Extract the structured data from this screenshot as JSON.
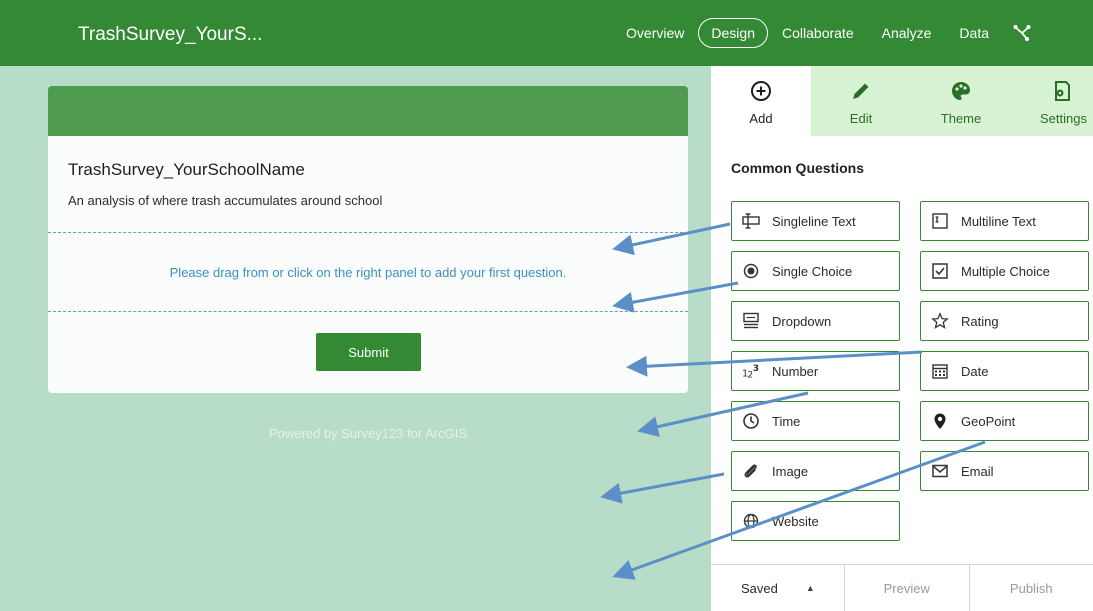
{
  "header": {
    "app_title": "TrashSurvey_YourS...",
    "nav": [
      {
        "label": "Overview",
        "active": false
      },
      {
        "label": "Design",
        "active": true
      },
      {
        "label": "Collaborate",
        "active": false
      },
      {
        "label": "Analyze",
        "active": false
      },
      {
        "label": "Data",
        "active": false
      }
    ],
    "share_icon": "share-icon"
  },
  "survey": {
    "title": "TrashSurvey_YourSchoolName",
    "description": "An analysis of where trash accumulates around school",
    "dropzone_text": "Please drag from or click on the right panel to add your first question.",
    "submit_label": "Submit",
    "powered_by": "Powered by Survey123 for ArcGIS"
  },
  "panel": {
    "tabs": [
      {
        "label": "Add",
        "icon": "plus-circle-icon",
        "active": true
      },
      {
        "label": "Edit",
        "icon": "pencil-icon",
        "active": false
      },
      {
        "label": "Theme",
        "icon": "palette-icon",
        "active": false
      },
      {
        "label": "Settings",
        "icon": "settings-doc-icon",
        "active": false
      }
    ],
    "section_title": "Common Questions",
    "questions": [
      {
        "label": "Singleline Text",
        "icon": "singleline-text-icon"
      },
      {
        "label": "Multiline Text",
        "icon": "multiline-text-icon"
      },
      {
        "label": "Single Choice",
        "icon": "radio-icon"
      },
      {
        "label": "Multiple Choice",
        "icon": "checkbox-icon"
      },
      {
        "label": "Dropdown",
        "icon": "dropdown-icon"
      },
      {
        "label": "Rating",
        "icon": "star-icon"
      },
      {
        "label": "Number",
        "icon": "number-icon"
      },
      {
        "label": "Date",
        "icon": "calendar-icon"
      },
      {
        "label": "Time",
        "icon": "clock-icon"
      },
      {
        "label": "GeoPoint",
        "icon": "map-pin-icon"
      },
      {
        "label": "Image",
        "icon": "paperclip-icon"
      },
      {
        "label": "Email",
        "icon": "envelope-icon"
      },
      {
        "label": "Website",
        "icon": "globe-icon"
      }
    ],
    "bottom": {
      "saved_label": "Saved",
      "preview_label": "Preview",
      "publish_label": "Publish"
    }
  },
  "colors": {
    "brand_green": "#348a34",
    "canvas_bg": "#b7dcc8",
    "link_blue": "#3b8fbf",
    "arrow_blue": "#5b8fc7"
  }
}
